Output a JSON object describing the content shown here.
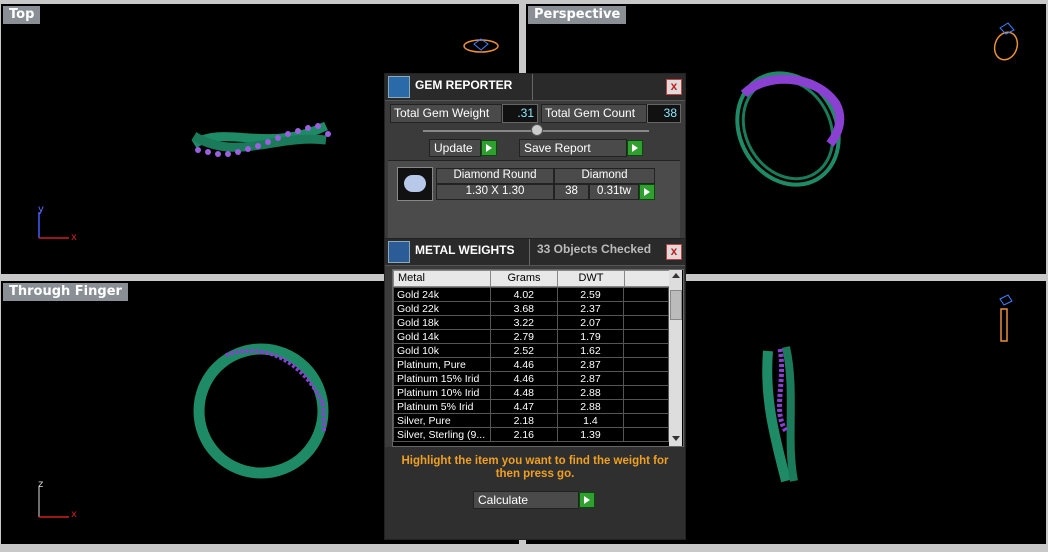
{
  "viewports": {
    "top": "Top",
    "perspective": "Perspective",
    "through_finger": "Through Finger"
  },
  "axes": {
    "y": "y",
    "x": "x",
    "z": "z"
  },
  "gem_reporter": {
    "title": "GEM REPORTER",
    "close": "x",
    "total_gem_weight_label": "Total Gem Weight",
    "total_gem_weight": ".31",
    "total_gem_count_label": "Total Gem Count",
    "total_gem_count": "38",
    "update_label": "Update",
    "save_report_label": "Save Report",
    "gem": {
      "shape": "Diamond Round",
      "material": "Diamond",
      "size": "1.30 X 1.30",
      "count": "38",
      "weight": "0.31tw"
    }
  },
  "metal_weights": {
    "title": "METAL WEIGHTS",
    "objects_checked": "33 Objects Checked",
    "close": "x",
    "columns": [
      "Metal",
      "Grams",
      "DWT"
    ],
    "rows": [
      {
        "metal": "Gold 24k",
        "grams": "4.02",
        "dwt": "2.59"
      },
      {
        "metal": "Gold 22k",
        "grams": "3.68",
        "dwt": "2.37"
      },
      {
        "metal": "Gold 18k",
        "grams": "3.22",
        "dwt": "2.07"
      },
      {
        "metal": "Gold 14k",
        "grams": "2.79",
        "dwt": "1.79"
      },
      {
        "metal": "Gold 10k",
        "grams": "2.52",
        "dwt": "1.62"
      },
      {
        "metal": "Platinum, Pure",
        "grams": "4.46",
        "dwt": "2.87"
      },
      {
        "metal": "Platinum 15% Irid",
        "grams": "4.46",
        "dwt": "2.87"
      },
      {
        "metal": "Platinum 10% Irid",
        "grams": "4.48",
        "dwt": "2.88"
      },
      {
        "metal": "Platinum 5% Irid",
        "grams": "4.47",
        "dwt": "2.88"
      },
      {
        "metal": "Silver, Pure",
        "grams": "2.18",
        "dwt": "1.4"
      },
      {
        "metal": "Silver, Sterling (9...",
        "grams": "2.16",
        "dwt": "1.39"
      }
    ],
    "instruction": "Highlight the item you want to find the weight for then press go.",
    "calculate_label": "Calculate"
  },
  "colors": {
    "viewport_bg": "#000000",
    "label_bg": "#8a8f96",
    "ring_green": "#1f8a66",
    "gem_purple": "#8a40d0",
    "instruction_text": "#f0a020"
  }
}
